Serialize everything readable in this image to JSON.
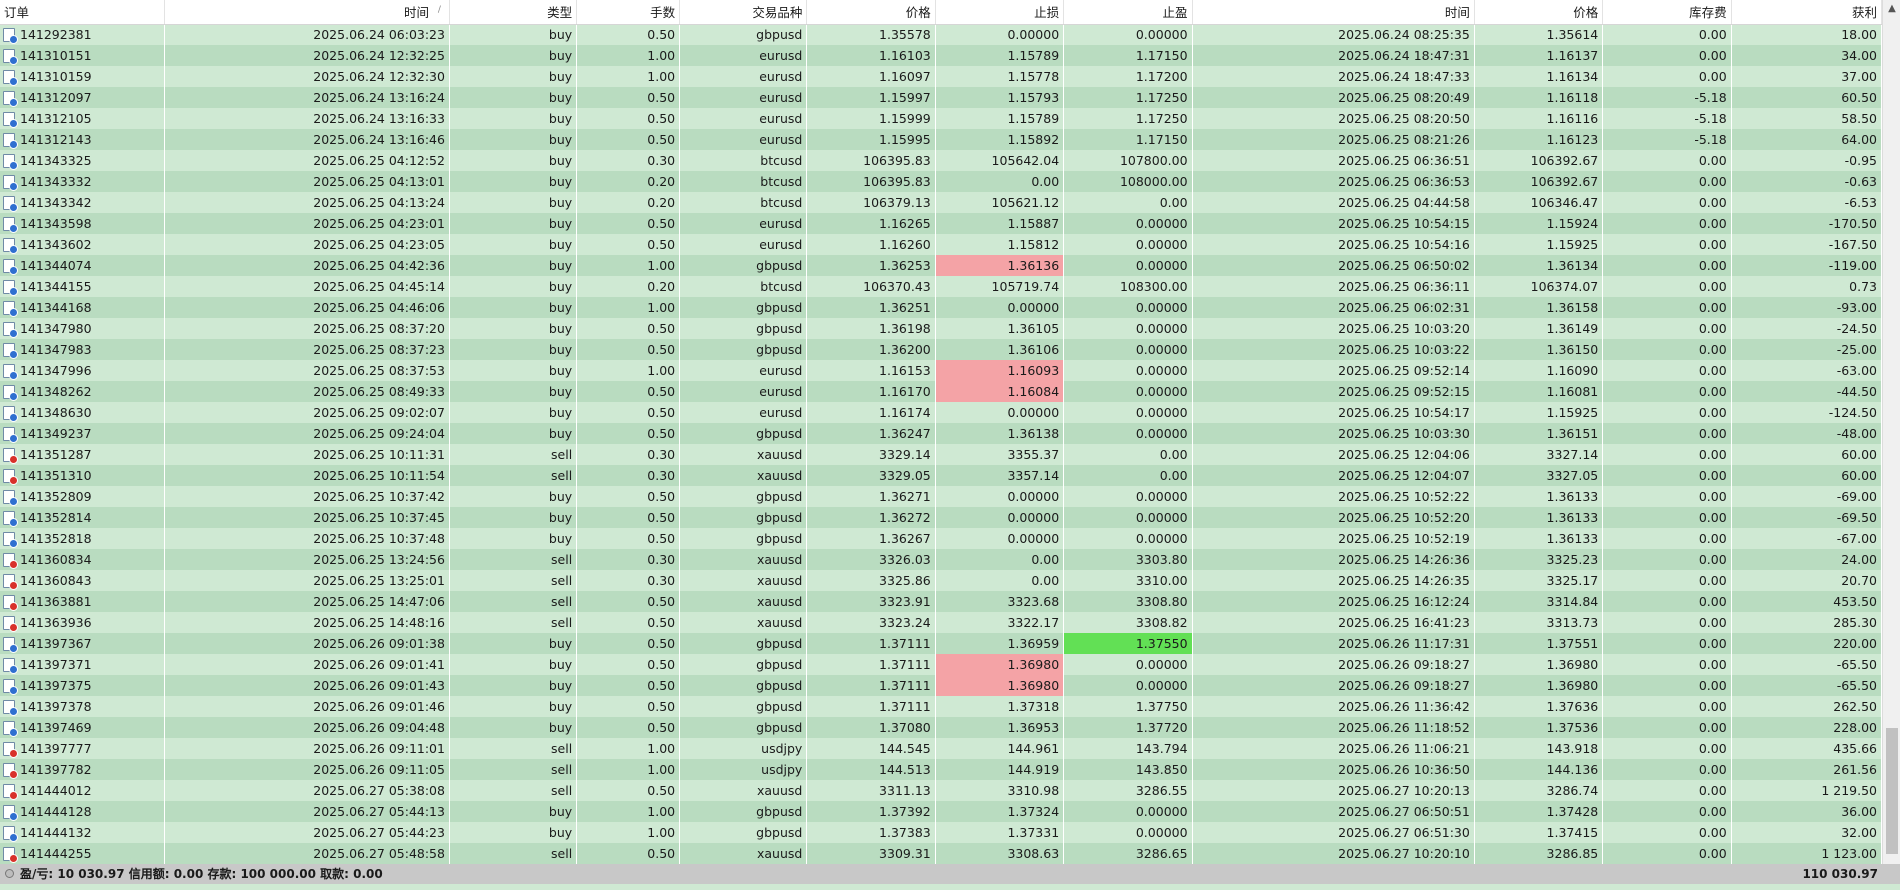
{
  "columns": [
    "订单",
    "时间",
    "类型",
    "手数",
    "交易品种",
    "价格",
    "止损",
    "止盈",
    "时间",
    "价格",
    "库存费",
    "获利"
  ],
  "rows": [
    {
      "order": "141292381",
      "open_time": "2025.06.24 06:03:23",
      "type": "buy",
      "lots": "0.50",
      "symbol": "gbpusd",
      "open_price": "1.35578",
      "sl": "0.00000",
      "tp": "0.00000",
      "close_time": "2025.06.24 08:25:35",
      "close_price": "1.35614",
      "swap": "0.00",
      "profit": "18.00"
    },
    {
      "order": "141310151",
      "open_time": "2025.06.24 12:32:25",
      "type": "buy",
      "lots": "1.00",
      "symbol": "eurusd",
      "open_price": "1.16103",
      "sl": "1.15789",
      "tp": "1.17150",
      "close_time": "2025.06.24 18:47:31",
      "close_price": "1.16137",
      "swap": "0.00",
      "profit": "34.00"
    },
    {
      "order": "141310159",
      "open_time": "2025.06.24 12:32:30",
      "type": "buy",
      "lots": "1.00",
      "symbol": "eurusd",
      "open_price": "1.16097",
      "sl": "1.15778",
      "tp": "1.17200",
      "close_time": "2025.06.24 18:47:33",
      "close_price": "1.16134",
      "swap": "0.00",
      "profit": "37.00"
    },
    {
      "order": "141312097",
      "open_time": "2025.06.24 13:16:24",
      "type": "buy",
      "lots": "0.50",
      "symbol": "eurusd",
      "open_price": "1.15997",
      "sl": "1.15793",
      "tp": "1.17250",
      "close_time": "2025.06.25 08:20:49",
      "close_price": "1.16118",
      "swap": "-5.18",
      "profit": "60.50"
    },
    {
      "order": "141312105",
      "open_time": "2025.06.24 13:16:33",
      "type": "buy",
      "lots": "0.50",
      "symbol": "eurusd",
      "open_price": "1.15999",
      "sl": "1.15789",
      "tp": "1.17250",
      "close_time": "2025.06.25 08:20:50",
      "close_price": "1.16116",
      "swap": "-5.18",
      "profit": "58.50"
    },
    {
      "order": "141312143",
      "open_time": "2025.06.24 13:16:46",
      "type": "buy",
      "lots": "0.50",
      "symbol": "eurusd",
      "open_price": "1.15995",
      "sl": "1.15892",
      "tp": "1.17150",
      "close_time": "2025.06.25 08:21:26",
      "close_price": "1.16123",
      "swap": "-5.18",
      "profit": "64.00"
    },
    {
      "order": "141343325",
      "open_time": "2025.06.25 04:12:52",
      "type": "buy",
      "lots": "0.30",
      "symbol": "btcusd",
      "open_price": "106395.83",
      "sl": "105642.04",
      "tp": "107800.00",
      "close_time": "2025.06.25 06:36:51",
      "close_price": "106392.67",
      "swap": "0.00",
      "profit": "-0.95"
    },
    {
      "order": "141343332",
      "open_time": "2025.06.25 04:13:01",
      "type": "buy",
      "lots": "0.20",
      "symbol": "btcusd",
      "open_price": "106395.83",
      "sl": "0.00",
      "tp": "108000.00",
      "close_time": "2025.06.25 06:36:53",
      "close_price": "106392.67",
      "swap": "0.00",
      "profit": "-0.63"
    },
    {
      "order": "141343342",
      "open_time": "2025.06.25 04:13:24",
      "type": "buy",
      "lots": "0.20",
      "symbol": "btcusd",
      "open_price": "106379.13",
      "sl": "105621.12",
      "tp": "0.00",
      "close_time": "2025.06.25 04:44:58",
      "close_price": "106346.47",
      "swap": "0.00",
      "profit": "-6.53"
    },
    {
      "order": "141343598",
      "open_time": "2025.06.25 04:23:01",
      "type": "buy",
      "lots": "0.50",
      "symbol": "eurusd",
      "open_price": "1.16265",
      "sl": "1.15887",
      "tp": "0.00000",
      "close_time": "2025.06.25 10:54:15",
      "close_price": "1.15924",
      "swap": "0.00",
      "profit": "-170.50"
    },
    {
      "order": "141343602",
      "open_time": "2025.06.25 04:23:05",
      "type": "buy",
      "lots": "0.50",
      "symbol": "eurusd",
      "open_price": "1.16260",
      "sl": "1.15812",
      "tp": "0.00000",
      "close_time": "2025.06.25 10:54:16",
      "close_price": "1.15925",
      "swap": "0.00",
      "profit": "-167.50"
    },
    {
      "order": "141344074",
      "open_time": "2025.06.25 04:42:36",
      "type": "buy",
      "lots": "1.00",
      "symbol": "gbpusd",
      "open_price": "1.36253",
      "sl": "1.36136",
      "tp": "0.00000",
      "close_time": "2025.06.25 06:50:02",
      "close_price": "1.36134",
      "swap": "0.00",
      "profit": "-119.00",
      "sl_hit": true
    },
    {
      "order": "141344155",
      "open_time": "2025.06.25 04:45:14",
      "type": "buy",
      "lots": "0.20",
      "symbol": "btcusd",
      "open_price": "106370.43",
      "sl": "105719.74",
      "tp": "108300.00",
      "close_time": "2025.06.25 06:36:11",
      "close_price": "106374.07",
      "swap": "0.00",
      "profit": "0.73"
    },
    {
      "order": "141344168",
      "open_time": "2025.06.25 04:46:06",
      "type": "buy",
      "lots": "1.00",
      "symbol": "gbpusd",
      "open_price": "1.36251",
      "sl": "0.00000",
      "tp": "0.00000",
      "close_time": "2025.06.25 06:02:31",
      "close_price": "1.36158",
      "swap": "0.00",
      "profit": "-93.00"
    },
    {
      "order": "141347980",
      "open_time": "2025.06.25 08:37:20",
      "type": "buy",
      "lots": "0.50",
      "symbol": "gbpusd",
      "open_price": "1.36198",
      "sl": "1.36105",
      "tp": "0.00000",
      "close_time": "2025.06.25 10:03:20",
      "close_price": "1.36149",
      "swap": "0.00",
      "profit": "-24.50"
    },
    {
      "order": "141347983",
      "open_time": "2025.06.25 08:37:23",
      "type": "buy",
      "lots": "0.50",
      "symbol": "gbpusd",
      "open_price": "1.36200",
      "sl": "1.36106",
      "tp": "0.00000",
      "close_time": "2025.06.25 10:03:22",
      "close_price": "1.36150",
      "swap": "0.00",
      "profit": "-25.00"
    },
    {
      "order": "141347996",
      "open_time": "2025.06.25 08:37:53",
      "type": "buy",
      "lots": "1.00",
      "symbol": "eurusd",
      "open_price": "1.16153",
      "sl": "1.16093",
      "tp": "0.00000",
      "close_time": "2025.06.25 09:52:14",
      "close_price": "1.16090",
      "swap": "0.00",
      "profit": "-63.00",
      "sl_hit": true
    },
    {
      "order": "141348262",
      "open_time": "2025.06.25 08:49:33",
      "type": "buy",
      "lots": "0.50",
      "symbol": "eurusd",
      "open_price": "1.16170",
      "sl": "1.16084",
      "tp": "0.00000",
      "close_time": "2025.06.25 09:52:15",
      "close_price": "1.16081",
      "swap": "0.00",
      "profit": "-44.50",
      "sl_hit": true
    },
    {
      "order": "141348630",
      "open_time": "2025.06.25 09:02:07",
      "type": "buy",
      "lots": "0.50",
      "symbol": "eurusd",
      "open_price": "1.16174",
      "sl": "0.00000",
      "tp": "0.00000",
      "close_time": "2025.06.25 10:54:17",
      "close_price": "1.15925",
      "swap": "0.00",
      "profit": "-124.50"
    },
    {
      "order": "141349237",
      "open_time": "2025.06.25 09:24:04",
      "type": "buy",
      "lots": "0.50",
      "symbol": "gbpusd",
      "open_price": "1.36247",
      "sl": "1.36138",
      "tp": "0.00000",
      "close_time": "2025.06.25 10:03:30",
      "close_price": "1.36151",
      "swap": "0.00",
      "profit": "-48.00"
    },
    {
      "order": "141351287",
      "open_time": "2025.06.25 10:11:31",
      "type": "sell",
      "lots": "0.30",
      "symbol": "xauusd",
      "open_price": "3329.14",
      "sl": "3355.37",
      "tp": "0.00",
      "close_time": "2025.06.25 12:04:06",
      "close_price": "3327.14",
      "swap": "0.00",
      "profit": "60.00"
    },
    {
      "order": "141351310",
      "open_time": "2025.06.25 10:11:54",
      "type": "sell",
      "lots": "0.30",
      "symbol": "xauusd",
      "open_price": "3329.05",
      "sl": "3357.14",
      "tp": "0.00",
      "close_time": "2025.06.25 12:04:07",
      "close_price": "3327.05",
      "swap": "0.00",
      "profit": "60.00"
    },
    {
      "order": "141352809",
      "open_time": "2025.06.25 10:37:42",
      "type": "buy",
      "lots": "0.50",
      "symbol": "gbpusd",
      "open_price": "1.36271",
      "sl": "0.00000",
      "tp": "0.00000",
      "close_time": "2025.06.25 10:52:22",
      "close_price": "1.36133",
      "swap": "0.00",
      "profit": "-69.00"
    },
    {
      "order": "141352814",
      "open_time": "2025.06.25 10:37:45",
      "type": "buy",
      "lots": "0.50",
      "symbol": "gbpusd",
      "open_price": "1.36272",
      "sl": "0.00000",
      "tp": "0.00000",
      "close_time": "2025.06.25 10:52:20",
      "close_price": "1.36133",
      "swap": "0.00",
      "profit": "-69.50"
    },
    {
      "order": "141352818",
      "open_time": "2025.06.25 10:37:48",
      "type": "buy",
      "lots": "0.50",
      "symbol": "gbpusd",
      "open_price": "1.36267",
      "sl": "0.00000",
      "tp": "0.00000",
      "close_time": "2025.06.25 10:52:19",
      "close_price": "1.36133",
      "swap": "0.00",
      "profit": "-67.00"
    },
    {
      "order": "141360834",
      "open_time": "2025.06.25 13:24:56",
      "type": "sell",
      "lots": "0.30",
      "symbol": "xauusd",
      "open_price": "3326.03",
      "sl": "0.00",
      "tp": "3303.80",
      "close_time": "2025.06.25 14:26:36",
      "close_price": "3325.23",
      "swap": "0.00",
      "profit": "24.00"
    },
    {
      "order": "141360843",
      "open_time": "2025.06.25 13:25:01",
      "type": "sell",
      "lots": "0.30",
      "symbol": "xauusd",
      "open_price": "3325.86",
      "sl": "0.00",
      "tp": "3310.00",
      "close_time": "2025.06.25 14:26:35",
      "close_price": "3325.17",
      "swap": "0.00",
      "profit": "20.70"
    },
    {
      "order": "141363881",
      "open_time": "2025.06.25 14:47:06",
      "type": "sell",
      "lots": "0.50",
      "symbol": "xauusd",
      "open_price": "3323.91",
      "sl": "3323.68",
      "tp": "3308.80",
      "close_time": "2025.06.25 16:12:24",
      "close_price": "3314.84",
      "swap": "0.00",
      "profit": "453.50"
    },
    {
      "order": "141363936",
      "open_time": "2025.06.25 14:48:16",
      "type": "sell",
      "lots": "0.50",
      "symbol": "xauusd",
      "open_price": "3323.24",
      "sl": "3322.17",
      "tp": "3308.82",
      "close_time": "2025.06.25 16:41:23",
      "close_price": "3313.73",
      "swap": "0.00",
      "profit": "285.30"
    },
    {
      "order": "141397367",
      "open_time": "2025.06.26 09:01:38",
      "type": "buy",
      "lots": "0.50",
      "symbol": "gbpusd",
      "open_price": "1.37111",
      "sl": "1.36959",
      "tp": "1.37550",
      "close_time": "2025.06.26 11:17:31",
      "close_price": "1.37551",
      "swap": "0.00",
      "profit": "220.00",
      "tp_hit": true
    },
    {
      "order": "141397371",
      "open_time": "2025.06.26 09:01:41",
      "type": "buy",
      "lots": "0.50",
      "symbol": "gbpusd",
      "open_price": "1.37111",
      "sl": "1.36980",
      "tp": "0.00000",
      "close_time": "2025.06.26 09:18:27",
      "close_price": "1.36980",
      "swap": "0.00",
      "profit": "-65.50",
      "sl_hit": true
    },
    {
      "order": "141397375",
      "open_time": "2025.06.26 09:01:43",
      "type": "buy",
      "lots": "0.50",
      "symbol": "gbpusd",
      "open_price": "1.37111",
      "sl": "1.36980",
      "tp": "0.00000",
      "close_time": "2025.06.26 09:18:27",
      "close_price": "1.36980",
      "swap": "0.00",
      "profit": "-65.50",
      "sl_hit": true
    },
    {
      "order": "141397378",
      "open_time": "2025.06.26 09:01:46",
      "type": "buy",
      "lots": "0.50",
      "symbol": "gbpusd",
      "open_price": "1.37111",
      "sl": "1.37318",
      "tp": "1.37750",
      "close_time": "2025.06.26 11:36:42",
      "close_price": "1.37636",
      "swap": "0.00",
      "profit": "262.50"
    },
    {
      "order": "141397469",
      "open_time": "2025.06.26 09:04:48",
      "type": "buy",
      "lots": "0.50",
      "symbol": "gbpusd",
      "open_price": "1.37080",
      "sl": "1.36953",
      "tp": "1.37720",
      "close_time": "2025.06.26 11:18:52",
      "close_price": "1.37536",
      "swap": "0.00",
      "profit": "228.00"
    },
    {
      "order": "141397777",
      "open_time": "2025.06.26 09:11:01",
      "type": "sell",
      "lots": "1.00",
      "symbol": "usdjpy",
      "open_price": "144.545",
      "sl": "144.961",
      "tp": "143.794",
      "close_time": "2025.06.26 11:06:21",
      "close_price": "143.918",
      "swap": "0.00",
      "profit": "435.66"
    },
    {
      "order": "141397782",
      "open_time": "2025.06.26 09:11:05",
      "type": "sell",
      "lots": "1.00",
      "symbol": "usdjpy",
      "open_price": "144.513",
      "sl": "144.919",
      "tp": "143.850",
      "close_time": "2025.06.26 10:36:50",
      "close_price": "144.136",
      "swap": "0.00",
      "profit": "261.56"
    },
    {
      "order": "141444012",
      "open_time": "2025.06.27 05:38:08",
      "type": "sell",
      "lots": "0.50",
      "symbol": "xauusd",
      "open_price": "3311.13",
      "sl": "3310.98",
      "tp": "3286.55",
      "close_time": "2025.06.27 10:20:13",
      "close_price": "3286.74",
      "swap": "0.00",
      "profit": "1 219.50"
    },
    {
      "order": "141444128",
      "open_time": "2025.06.27 05:44:13",
      "type": "buy",
      "lots": "1.00",
      "symbol": "gbpusd",
      "open_price": "1.37392",
      "sl": "1.37324",
      "tp": "0.00000",
      "close_time": "2025.06.27 06:50:51",
      "close_price": "1.37428",
      "swap": "0.00",
      "profit": "36.00"
    },
    {
      "order": "141444132",
      "open_time": "2025.06.27 05:44:23",
      "type": "buy",
      "lots": "1.00",
      "symbol": "gbpusd",
      "open_price": "1.37383",
      "sl": "1.37331",
      "tp": "0.00000",
      "close_time": "2025.06.27 06:51:30",
      "close_price": "1.37415",
      "swap": "0.00",
      "profit": "32.00"
    },
    {
      "order": "141444255",
      "open_time": "2025.06.27 05:48:58",
      "type": "sell",
      "lots": "0.50",
      "symbol": "xauusd",
      "open_price": "3309.31",
      "sl": "3308.63",
      "tp": "3286.65",
      "close_time": "2025.06.27 10:20:10",
      "close_price": "3286.85",
      "swap": "0.00",
      "profit": "1 123.00"
    }
  ],
  "summary": {
    "text": "盈/亏: 10 030.97  信用额: 0.00  存款: 100 000.00  取款: 0.00",
    "total": "110 030.97"
  },
  "colors": {
    "row_light": "#cfe9d3",
    "row_dark": "#b9dcc0",
    "sl_hit": "#f4a3a6",
    "tp_hit": "#62e055",
    "buy_icon": "#2f6fd0",
    "sell_icon": "#d8312a"
  },
  "icons": {
    "sort": "sort-indicator-icon",
    "order_doc": "order-document-icon",
    "scroll_up": "scroll-up-arrow-icon"
  }
}
